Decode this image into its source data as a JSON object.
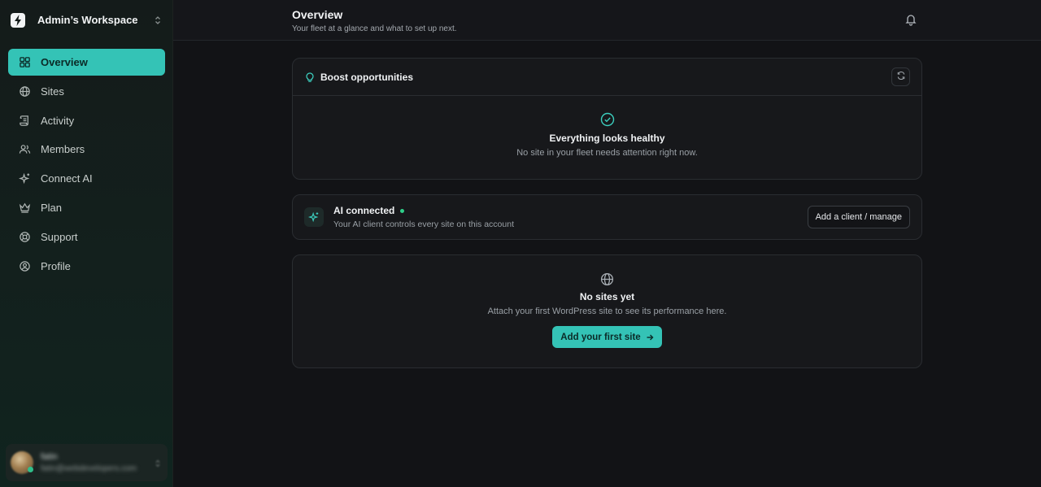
{
  "workspace": {
    "name": "Admin’s Workspace",
    "logo_icon": "lightning-logo",
    "switch_icon": "chevron-updown-icon"
  },
  "sidebar": {
    "items": [
      {
        "label": "Overview",
        "icon": "grid-icon",
        "active": true
      },
      {
        "label": "Sites",
        "icon": "globe-icon",
        "active": false
      },
      {
        "label": "Activity",
        "icon": "scroll-icon",
        "active": false
      },
      {
        "label": "Members",
        "icon": "users-icon",
        "active": false
      },
      {
        "label": "Connect AI",
        "icon": "sparkles-icon",
        "active": false
      },
      {
        "label": "Plan",
        "icon": "crown-icon",
        "active": false
      },
      {
        "label": "Support",
        "icon": "lifebuoy-icon",
        "active": false
      },
      {
        "label": "Profile",
        "icon": "user-circle-icon",
        "active": false
      }
    ]
  },
  "user": {
    "name": "fatin",
    "email": "fatin@webdevelopers.com"
  },
  "header": {
    "title": "Overview",
    "subtitle": "Your fleet at a glance and what to set up next."
  },
  "boost": {
    "title": "Boost opportunities",
    "status_title": "Everything looks healthy",
    "status_sub": "No site in your fleet needs attention right now."
  },
  "ai": {
    "title": "AI connected",
    "subtitle": "Your AI client controls every site on this account",
    "button_label": "Add a client / manage"
  },
  "sites": {
    "title": "No sites yet",
    "subtitle": "Attach your first WordPress site to see its performance here.",
    "button_label": "Add your first site"
  },
  "colors": {
    "accent": "#34c3b6",
    "status_green": "#2fcf8a"
  }
}
